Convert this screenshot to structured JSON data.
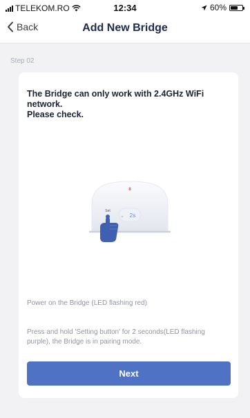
{
  "status_bar": {
    "carrier": "TELEKOM.RO",
    "time": "12:34",
    "battery": "60%",
    "battery_level": 0.6,
    "icons": [
      "signal-icon",
      "wifi-icon",
      "location-arrow-icon",
      "battery-icon"
    ]
  },
  "nav": {
    "back_label": "Back",
    "title": "Add New Bridge",
    "back_icon": "chevron-left-icon"
  },
  "step_label": "Step 02",
  "card": {
    "heading": "The Bridge can only work with 2.4GHz WiFi network.\nPlease check.",
    "illustration": {
      "set_label": "Set",
      "timer_label": "2s",
      "led_label": "8"
    },
    "instruction_1": "Power on the Bridge (LED flashing red)",
    "instruction_2": "Press and hold 'Setting button' for 2 seconds(LED flashing purple), the Bridge is in pairing mode.",
    "next_label": "Next"
  },
  "colors": {
    "accent": "#4f72c4",
    "background": "#f2f2f4",
    "card": "#ffffff",
    "heading_text": "#1b2233",
    "muted_text": "#8f949e",
    "led_red": "#e04a4a"
  }
}
